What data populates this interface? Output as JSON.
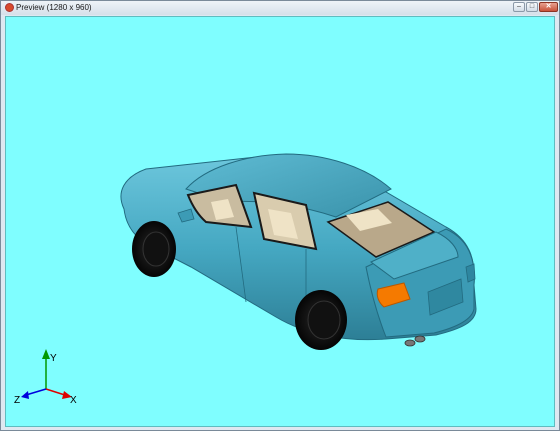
{
  "window": {
    "title": "Preview (1280 x 960)",
    "min_glyph": "–",
    "max_glyph": "□",
    "close_glyph": "✕",
    "icon": "app-icon"
  },
  "viewport": {
    "background": "#7ffeff",
    "model": "car-3d-model",
    "car_color": "#45a8c2",
    "light_color": "#f57a00"
  },
  "axes": {
    "y_label": "Y",
    "x_label": "X",
    "z_label": "Z",
    "y_color": "#009900",
    "x_color": "#dd0000",
    "z_color": "#0000dd"
  }
}
